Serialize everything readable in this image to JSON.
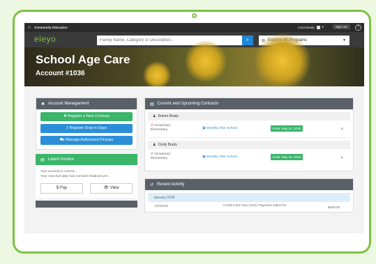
{
  "topbar": {
    "community": "Community Education",
    "user": "Carol Brady",
    "logout": "Sign out",
    "help": "?"
  },
  "search": {
    "logo": "eleyo",
    "placeholder": "Family Name, Category or Description...",
    "programs": "Explore All Programs"
  },
  "hero": {
    "title": "School Age Care",
    "account": "Account #1036"
  },
  "account_mgmt": {
    "heading": "Account Management",
    "buttons": [
      {
        "label": "Register a New Contract"
      },
      {
        "label": "Register Drop in Days"
      },
      {
        "label": "Manage Authorized Pickups"
      }
    ]
  },
  "invoice": {
    "heading": "Latest Invoice",
    "line1": "Your account is current.",
    "line2": "Your next due date has not been finalized yet.",
    "pay": "Pay",
    "view": "View"
  },
  "contracts": {
    "heading": "Current and Upcoming Contracts",
    "items": [
      {
        "child": "Robert Brady",
        "school": "Arrowhead",
        "level": "Elementary",
        "program": "Monthly After School",
        "ends": "Ends: May 31, 2018"
      },
      {
        "child": "Cindy Brady",
        "school": "Arrowhead",
        "level": "Elementary",
        "program": "Monthly After School",
        "ends": "Ends: May 31, 2018"
      }
    ]
  },
  "activity": {
    "heading": "Recent Activity",
    "month": "January 2018",
    "rows": [
      {
        "date": "01/02/18",
        "desc": "Credit Card Visa (1111) Payment online for",
        "amount": "$400.00"
      }
    ]
  },
  "colors": {
    "accent_green": "#3ab56a",
    "accent_blue": "#2b8fd8",
    "frame_green": "#7cc242"
  }
}
